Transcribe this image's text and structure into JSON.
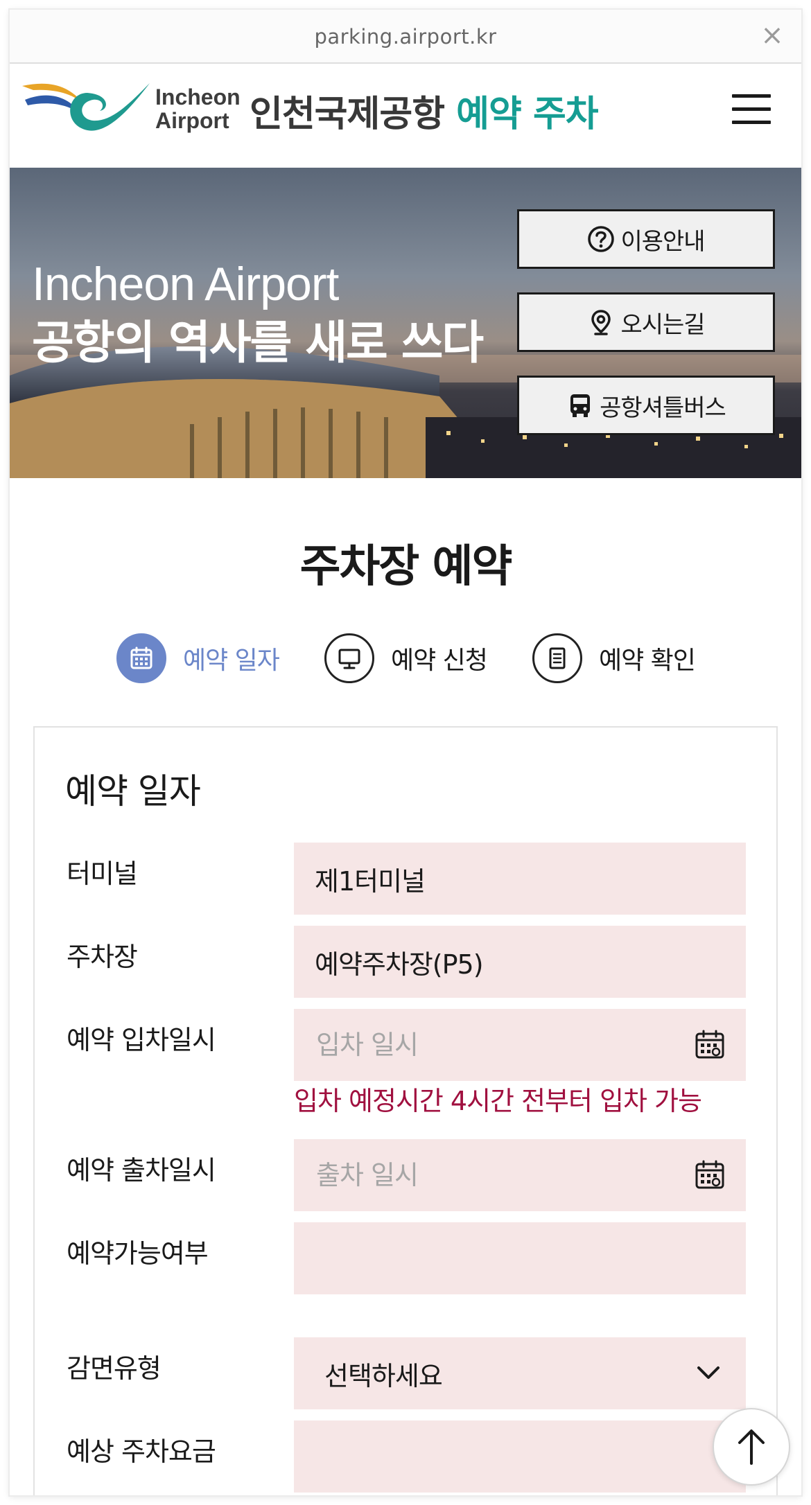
{
  "browser": {
    "url": "parking.airport.kr",
    "close_symbol": "×"
  },
  "header": {
    "logo_line1": "Incheon",
    "logo_line2": "Airport",
    "title_main": "인천국제공항",
    "title_accent": "예약 주차",
    "accent_color": "#159d93"
  },
  "hero": {
    "title_en": "Incheon Airport",
    "title_ko": "공항의 역사를 새로 쓰다",
    "buttons": [
      {
        "label": "이용안내",
        "icon": "question-circle-icon"
      },
      {
        "label": "오시는길",
        "icon": "map-pin-icon"
      },
      {
        "label": "공항셔틀버스",
        "icon": "bus-icon"
      }
    ]
  },
  "page_title": "주차장 예약",
  "steps": [
    {
      "label": "예약 일자",
      "icon": "calendar-icon",
      "active": true
    },
    {
      "label": "예약 신청",
      "icon": "monitor-icon",
      "active": false
    },
    {
      "label": "예약 확인",
      "icon": "document-icon",
      "active": false
    }
  ],
  "form": {
    "title": "예약 일자",
    "terminal": {
      "label": "터미널",
      "value": "제1터미널"
    },
    "parking_lot": {
      "label": "주차장",
      "value": "예약주차장(P5)"
    },
    "entry": {
      "label": "예약 입차일시",
      "placeholder": "입차 일시"
    },
    "entry_notice": "입차 예정시간 4시간 전부터 입차 가능",
    "exit": {
      "label": "예약 출차일시",
      "placeholder": "출차 일시"
    },
    "availability": {
      "label": "예약가능여부",
      "value": ""
    },
    "discount": {
      "label": "감면유형",
      "selected": "선택하세요"
    },
    "fee": {
      "label": "예상 주차요금",
      "value": ""
    }
  },
  "colors": {
    "step_active": "#6b86c9",
    "field_bg": "#f6e6e6",
    "notice": "#a0103f"
  }
}
